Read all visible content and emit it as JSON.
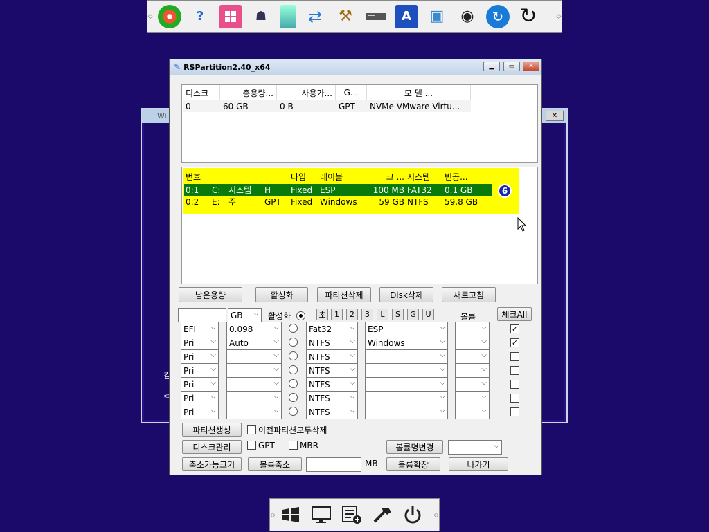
{
  "main_window": {
    "title": "RSPartition2.40_x64"
  },
  "disk_list": {
    "headers": [
      "디스크",
      "총용량...",
      "사용가...",
      "G...",
      "모  델  ..."
    ],
    "rows": [
      [
        "0",
        "60 GB",
        "0 B",
        "GPT",
        "NVMe VMware Virtu..."
      ]
    ]
  },
  "partition_list": {
    "headers": [
      "번호",
      "",
      "",
      "",
      "타입",
      "레이블",
      "크 ...",
      "시스템",
      "빈공..."
    ],
    "rows": [
      [
        "0:1",
        "C:",
        "시스템",
        "H",
        "Fixed",
        "ESP",
        "100 MB",
        "FAT32",
        "0.1 GB"
      ],
      [
        "0:2",
        "E:",
        "주",
        "GPT",
        "Fixed",
        "Windows",
        "59 GB",
        "NTFS",
        "59.8 GB"
      ]
    ],
    "selected_row": 0,
    "badge": "6"
  },
  "action_buttons": [
    "남은용량",
    "활성화",
    "파티션삭제",
    "Disk삭제",
    "새로고침"
  ],
  "options_row": {
    "size_value": "",
    "unit": "GB",
    "active_label": "활성화",
    "init_buttons": [
      "초",
      "1",
      "2",
      "3",
      "L",
      "S",
      "G",
      "U"
    ],
    "volume_label": "볼륨",
    "check_all_label": "체크All"
  },
  "partition_rows": [
    {
      "type": "EFI",
      "size": "0.098",
      "fs": "Fat32",
      "label": "ESP",
      "checked": true
    },
    {
      "type": "Pri",
      "size": "Auto",
      "fs": "NTFS",
      "label": "Windows",
      "checked": true
    },
    {
      "type": "Pri",
      "size": "",
      "fs": "NTFS",
      "label": "",
      "checked": false
    },
    {
      "type": "Pri",
      "size": "",
      "fs": "NTFS",
      "label": "",
      "checked": false
    },
    {
      "type": "Pri",
      "size": "",
      "fs": "NTFS",
      "label": "",
      "checked": false
    },
    {
      "type": "Pri",
      "size": "",
      "fs": "NTFS",
      "label": "",
      "checked": false
    },
    {
      "type": "Pri",
      "size": "",
      "fs": "NTFS",
      "label": "",
      "checked": false
    }
  ],
  "bottom_controls": {
    "create_partition": "파티션생성",
    "delete_prev_label": "이전파티션모두삭제",
    "disk_manage": "디스크관리",
    "gpt_label": "GPT",
    "mbr_label": "MBR",
    "rename_volume": "볼륨명변경",
    "shrinkable_size": "축소가능크기",
    "shrink_volume": "볼륨축소",
    "mb_label": "MB",
    "extend_volume": "볼륨확장",
    "exit": "나가기"
  },
  "background_window": {
    "title": "Wi",
    "side_text_1": "컴",
    "side_text_2": "©"
  },
  "top_bar_icons": [
    "disk-icon",
    "help-icon",
    "windows-tiles-icon",
    "users-icon",
    "phone-icon",
    "network-icon",
    "tools-icon",
    "drive-icon",
    "a-icon",
    "computer-icon",
    "camera-icon",
    "sync-icon",
    "refresh-icon"
  ],
  "bottom_bar_icons": [
    "windows-flag-icon",
    "monitor-icon",
    "tasklist-icon",
    "hammer-icon",
    "power-icon"
  ]
}
